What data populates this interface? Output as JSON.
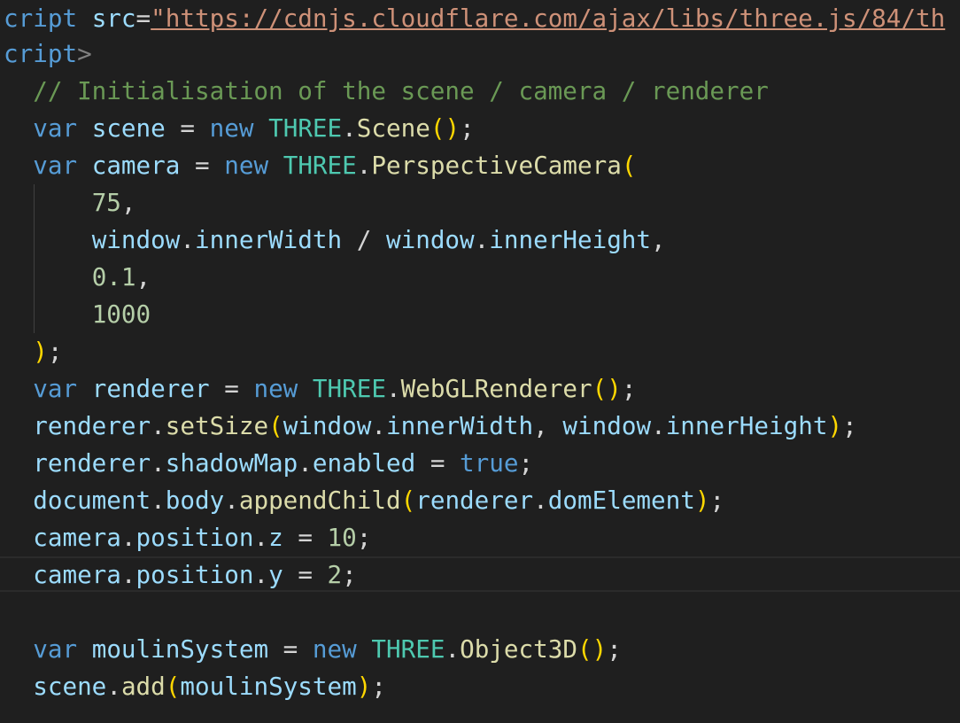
{
  "editor": {
    "lines": {
      "l1": {
        "tag": "cript",
        "attr": " src",
        "eq": "=",
        "value": "\"https://cdnjs.cloudflare.com/ajax/libs/three.js/84/th"
      },
      "l2": {
        "tag": "cript",
        "close": ">"
      },
      "l3": {
        "comment": "// Initialisation of the scene / camera / renderer"
      },
      "l4": {
        "kw": "var",
        "name": "scene",
        "eq": " = ",
        "new": "new",
        "ns": "THREE",
        "dot": ".",
        "ctor": "Scene",
        "open": "(",
        "close": ")",
        "semi": ";"
      },
      "l5": {
        "kw": "var",
        "name": "camera",
        "eq": " = ",
        "new": "new",
        "ns": "THREE",
        "dot": ".",
        "ctor": "PerspectiveCamera",
        "open": "("
      },
      "l6": {
        "num": "75",
        "comma": ","
      },
      "l7": {
        "a_obj": "window",
        "a_dot": ".",
        "a_prop": "innerWidth",
        "op": " / ",
        "b_obj": "window",
        "b_dot": ".",
        "b_prop": "innerHeight",
        "comma": ","
      },
      "l8": {
        "num": "0.1",
        "comma": ","
      },
      "l9": {
        "num": "1000"
      },
      "l10": {
        "close": ")",
        "semi": ";"
      },
      "l11": {
        "kw": "var",
        "name": "renderer",
        "eq": " = ",
        "new": "new",
        "ns": "THREE",
        "dot": ".",
        "ctor": "WebGLRenderer",
        "open": "(",
        "close": ")",
        "semi": ";"
      },
      "l12": {
        "obj": "renderer",
        "dot": ".",
        "fn": "setSize",
        "open": "(",
        "a_obj": "window",
        "a_dot": ".",
        "a_prop": "innerWidth",
        "sep": ", ",
        "b_obj": "window",
        "b_dot": ".",
        "b_prop": "innerHeight",
        "close": ")",
        "semi": ";"
      },
      "l13": {
        "obj": "renderer",
        "dot1": ".",
        "p1": "shadowMap",
        "dot2": ".",
        "p2": "enabled",
        "eq": " = ",
        "val": "true",
        "semi": ";"
      },
      "l14": {
        "obj": "document",
        "dot1": ".",
        "p1": "body",
        "dot2": ".",
        "fn": "appendChild",
        "open": "(",
        "a_obj": "renderer",
        "a_dot": ".",
        "a_prop": "domElement",
        "close": ")",
        "semi": ";"
      },
      "l15": {
        "obj": "camera",
        "dot1": ".",
        "p1": "position",
        "dot2": ".",
        "p2": "z",
        "eq": " = ",
        "num": "10",
        "semi": ";"
      },
      "l16": {
        "obj": "camera",
        "dot1": ".",
        "p1": "position",
        "dot2": ".",
        "p2": "y",
        "eq": " = ",
        "num": "2",
        "semi": ";"
      },
      "l18": {
        "kw": "var",
        "name": "moulinSystem",
        "eq": " = ",
        "new": "new",
        "ns": "THREE",
        "dot": ".",
        "ctor": "Object3D",
        "open": "(",
        "close": ")",
        "semi": ";"
      },
      "l19": {
        "obj": "scene",
        "dot": ".",
        "fn": "add",
        "open": "(",
        "arg": "moulinSystem",
        "close": ")",
        "semi": ";"
      }
    }
  },
  "colors": {
    "background": "#1f1f1f",
    "keyword": "#569cd6",
    "variable": "#9cdcfe",
    "class": "#4ec9b0",
    "function": "#dcdcaa",
    "number": "#b5cea8",
    "comment": "#6a9955",
    "string": "#ce9178",
    "bracket": "#ffd700"
  }
}
